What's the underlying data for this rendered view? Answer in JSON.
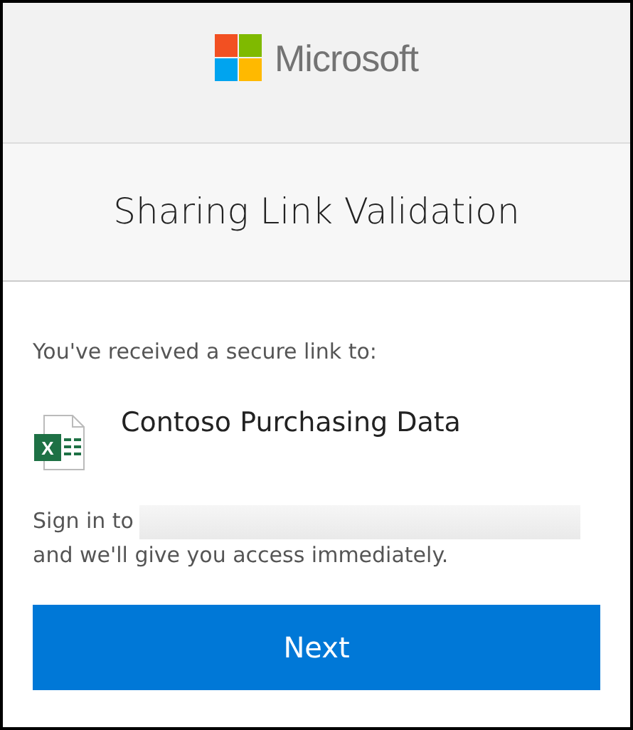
{
  "header": {
    "brand": "Microsoft"
  },
  "title": "Sharing Link Validation",
  "message": "You've received a secure link to:",
  "file": {
    "kind": "excel",
    "icon_letter": "X",
    "name": "Contoso Purchasing Data"
  },
  "sign_in": {
    "prefix": "Sign in to",
    "suffix": "and we'll give you access immediately."
  },
  "buttons": [
    {
      "label": "Next"
    }
  ]
}
